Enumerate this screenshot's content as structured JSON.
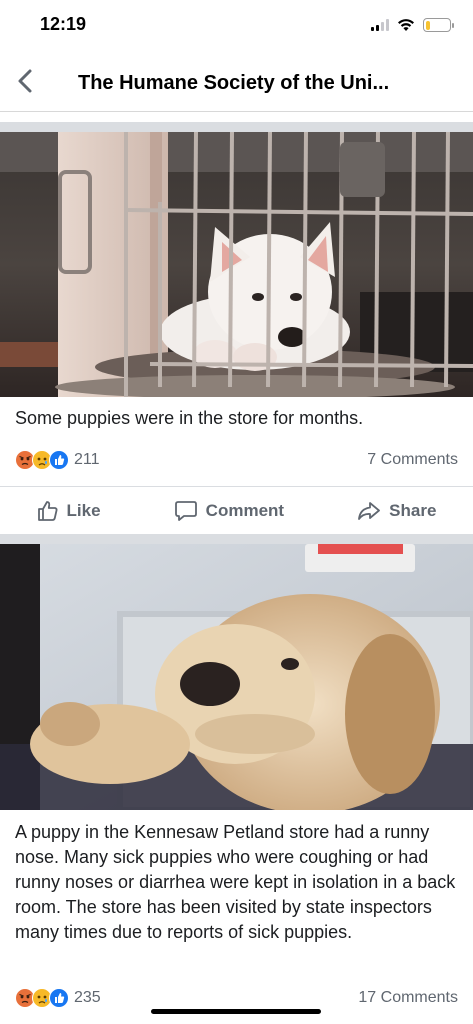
{
  "status_bar": {
    "time": "12:19",
    "signal_icon": "cellular-signal-icon",
    "wifi_icon": "wifi-icon",
    "battery_icon": "battery-low-icon",
    "battery_level": 0.2,
    "battery_color": "#f7c331"
  },
  "nav": {
    "back_icon": "chevron-left-icon",
    "title": "The Humane Society of the Uni..."
  },
  "posts": [
    {
      "image_description_icon": "photo",
      "caption": "Some puppies were in the store for months.",
      "reactions": {
        "icons": [
          "angry-reaction-icon",
          "sad-reaction-icon",
          "like-reaction-icon"
        ],
        "count": "211"
      },
      "comments": "7 Comments",
      "actions": {
        "like": "Like",
        "comment": "Comment",
        "share": "Share"
      }
    },
    {
      "image_description_icon": "photo",
      "caption": "A puppy in the Kennesaw Petland store had a runny nose. Many sick puppies who were coughing or had runny noses or diarrhea were kept in isolation in a back room. The store has been visited by state inspectors many times due to reports of sick puppies.",
      "reactions": {
        "icons": [
          "angry-reaction-icon",
          "sad-reaction-icon",
          "like-reaction-icon"
        ],
        "count": "235"
      },
      "comments": "17 Comments"
    }
  ],
  "colors": {
    "facebook_blue": "#1877f2",
    "angry_orange": "#e8703a",
    "sad_yellow": "#f7b928",
    "secondary_text": "#606770",
    "divider": "#dadde1"
  }
}
